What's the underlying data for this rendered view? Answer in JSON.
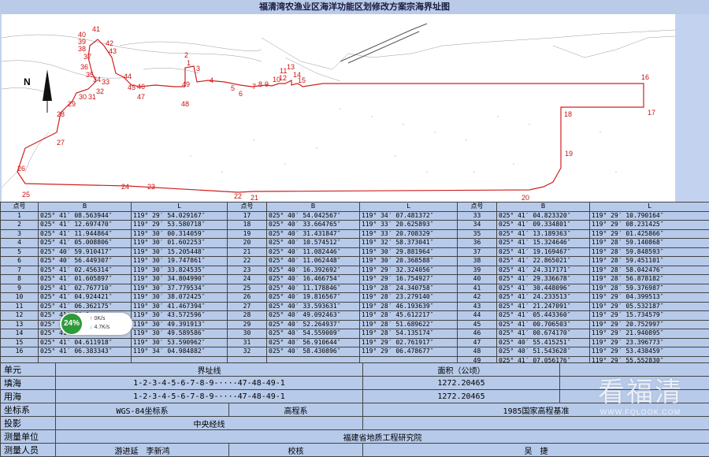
{
  "title": "福清湾农渔业区海洋功能区划修改方案宗海界址图",
  "map": {
    "north_label": "N",
    "point_labels": [
      "1",
      "2",
      "3",
      "4",
      "5",
      "6",
      "7",
      "8",
      "9",
      "10",
      "11",
      "12",
      "13",
      "14",
      "15",
      "16",
      "17",
      "18",
      "19",
      "20",
      "21",
      "22",
      "23",
      "24",
      "25",
      "26",
      "27",
      "28",
      "29",
      "30",
      "31",
      "32",
      "33",
      "34",
      "35",
      "36",
      "37",
      "38",
      "39",
      "40",
      "41",
      "42",
      "43",
      "44",
      "45",
      "46",
      "47",
      "48",
      "49"
    ]
  },
  "table": {
    "headers": [
      "点号",
      "B",
      "L",
      "点号",
      "B",
      "L",
      "点号",
      "B",
      "L"
    ],
    "rows": [
      [
        "1",
        "025° 41′ 08.563944″",
        "119° 29′ 54.029167″",
        "17",
        "025° 40′ 54.042567″",
        "119° 34′ 07.481372″",
        "33",
        "025° 41′ 04.823320″",
        "119° 29′ 10.790164″"
      ],
      [
        "2",
        "025° 41′ 12.697470″",
        "119° 29′ 53.580718″",
        "18",
        "025° 40′ 33.664765″",
        "119° 33′ 20.625893″",
        "34",
        "025° 41′ 09.334801″",
        "119° 29′ 08.231425″"
      ],
      [
        "3",
        "025° 41′ 11.944864″",
        "119° 30′ 00.314059″",
        "19",
        "025° 40′ 31.431847″",
        "119° 33′ 20.708329″",
        "35",
        "025° 41′ 13.189363″",
        "119° 29′ 01.425866″"
      ],
      [
        "4",
        "025° 41′ 05.008806″",
        "119° 30′ 01.602253″",
        "20",
        "025° 40′ 10.574512″",
        "119° 32′ 58.373041″",
        "36",
        "025° 41′ 15.324646″",
        "119° 28′ 59.140868″"
      ],
      [
        "5",
        "025° 40′ 59.910417″",
        "119° 30′ 15.205448″",
        "21",
        "025° 40′ 11.082446″",
        "119° 30′ 29.881964″",
        "37",
        "025° 41′ 19.169467″",
        "119° 28′ 59.848593″"
      ],
      [
        "6",
        "025° 40′ 56.449307″",
        "119° 30′ 19.747861″",
        "22",
        "025° 40′ 11.062448″",
        "119° 30′ 20.368588″",
        "38",
        "025° 41′ 22.865021″",
        "119° 28′ 59.451101″"
      ],
      [
        "7",
        "025° 41′ 02.456314″",
        "119° 30′ 33.824535″",
        "23",
        "025° 40′ 16.392692″",
        "119° 29′ 32.324056″",
        "39",
        "025° 41′ 24.317171″",
        "119° 28′ 58.042476″"
      ],
      [
        "8",
        "025° 41′ 01.605897″",
        "119° 30′ 34.804990″",
        "24",
        "025° 40′ 16.466754″",
        "119° 29′ 16.754927″",
        "40",
        "025° 41′ 29.336678″",
        "119° 28′ 56.878182″"
      ],
      [
        "9",
        "025° 41′ 02.767710″",
        "119° 30′ 37.779534″",
        "25",
        "025° 40′ 11.178846″",
        "119° 28′ 24.340758″",
        "41",
        "025° 41′ 30.448096″",
        "119° 28′ 59.376987″"
      ],
      [
        "10",
        "025° 41′ 04.924421″",
        "119° 30′ 38.072425″",
        "26",
        "025° 40′ 19.816567″",
        "119° 28′ 23.279140″",
        "42",
        "025° 41′ 24.233513″",
        "119° 29′ 04.399513″"
      ],
      [
        "11",
        "025° 41′ 06.362175″",
        "119° 30′ 41.467394″",
        "27",
        "025° 40′ 33.593631″",
        "119° 28′ 46.193639″",
        "43",
        "025° 41′ 21.247091″",
        "119° 29′ 05.532187″"
      ],
      [
        "12",
        "025° 41′ 06.1",
        "119° 30′ 43.572596″",
        "28",
        "025° 40′ 49.092463″",
        "119° 28′ 45.612217″",
        "44",
        "025° 41′ 05.443360″",
        "119° 29′ 15.734579″"
      ],
      [
        "13",
        "025° 41′ 0",
        "119° 30′ 49.391913″",
        "29",
        "025° 40′ 52.264937″",
        "119° 28′ 51.689622″",
        "45",
        "025° 41′ 00.706503″",
        "119° 29′ 20.752997″"
      ],
      [
        "14",
        "025° 41′ 06.977386″",
        "119° 30′ 49.589586″",
        "30",
        "025° 40′ 54.559009″",
        "119° 28′ 54.135174″",
        "46",
        "025° 41′ 00.674170″",
        "119° 29′ 21.940895″"
      ],
      [
        "15",
        "025° 41′ 04.611918″",
        "119° 30′ 53.590962″",
        "31",
        "025° 40′ 56.910644″",
        "119° 29′ 02.761917″",
        "47",
        "025° 40′ 55.415251″",
        "119° 29′ 23.396773″"
      ],
      [
        "16",
        "025° 41′ 06.383343″",
        "119° 34′ 04.984882″",
        "32",
        "025° 40′ 58.430896″",
        "119° 29′ 06.478677″",
        "48",
        "025° 40′ 51.543628″",
        "119° 29′ 53.438459″"
      ],
      [
        "",
        "",
        "",
        "",
        "",
        "",
        "49",
        "025° 41′ 07.056176″",
        "119° 29′ 55.552830″"
      ]
    ]
  },
  "bottom": {
    "unit_label": "单元",
    "boundary_label": "界址线",
    "area_label": "面积（公顷）",
    "rows": [
      {
        "label": "填海",
        "line": "1-2-3-4-5-6-7-8-9-···-47-48-49-1",
        "area": "1272.20465"
      },
      {
        "label": "用海",
        "line": "1-2-3-4-5-6-7-8-9-···-47-48-49-1",
        "area": "1272.20465"
      }
    ],
    "coord_label": "坐标系",
    "coord_value": "WGS-84坐标系",
    "elev_label": "高程系",
    "elev_value": "1985国家高程基准",
    "proj_label": "投影",
    "proj_value": "中央经线",
    "unit_survey_label": "测量单位",
    "unit_survey_value": "福建省地质工程研究院",
    "people_label": "测量人员",
    "people_value": "游进延　李新鸿",
    "check_label": "校核",
    "check_value": "吴　捷"
  },
  "overlay": {
    "percent": "24%",
    "up": "0K/s",
    "down": "4.7K/s"
  },
  "watermark": {
    "big": "看福清",
    "small": "WWW.FQLOOK.COM"
  }
}
